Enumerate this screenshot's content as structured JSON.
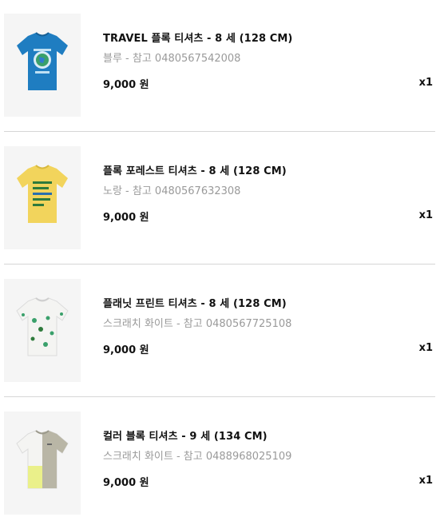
{
  "items": [
    {
      "title": "TRAVEL 플록 티셔츠 - 8 세 (128 CM)",
      "variant": "블루 - 참고 0480567542008",
      "price": "9,000 원",
      "quantity": "x1",
      "shirt_color": "#1f7dc1",
      "image_icon": "blue-travel-tshirt-image"
    },
    {
      "title": "플록 포레스트 티셔츠 - 8 세 (128 CM)",
      "variant": "노랑 - 참고 0480567632308",
      "price": "9,000 원",
      "quantity": "x1",
      "shirt_color": "#f2d45c",
      "image_icon": "yellow-forest-tshirt-image"
    },
    {
      "title": "플래닛 프린트 티셔츠 - 8 세 (128 CM)",
      "variant": "스크래치 화이트 - 참고 0480567725108",
      "price": "9,000 원",
      "quantity": "x1",
      "shirt_color": "#f4f4f2",
      "image_icon": "white-planet-print-tshirt-image"
    },
    {
      "title": "컬러 블록 티셔츠 - 9 세 (134 CM)",
      "variant": "스크래치 화이트 - 참고 0488968025109",
      "price": "9,000 원",
      "quantity": "x1",
      "shirt_color": "#f4f4f2",
      "image_icon": "color-block-tshirt-image"
    }
  ]
}
